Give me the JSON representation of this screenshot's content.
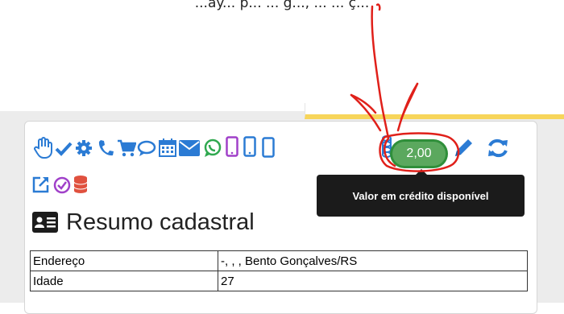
{
  "top_caption": "...ay... p... ... g..., ... ... ç...",
  "toolbar": {
    "icons": [
      {
        "name": "hand-icon",
        "color": "#2b7bd4"
      },
      {
        "name": "check-icon",
        "color": "#2b7bd4"
      },
      {
        "name": "gear-icon",
        "color": "#2b7bd4"
      },
      {
        "name": "phone-icon",
        "color": "#2b7bd4"
      },
      {
        "name": "cart-icon",
        "color": "#2b7bd4"
      },
      {
        "name": "chat-icon",
        "color": "#2b7bd4"
      },
      {
        "name": "calendar-icon",
        "color": "#2b7bd4"
      },
      {
        "name": "envelope-icon",
        "color": "#2b7bd4"
      },
      {
        "name": "whatsapp-icon",
        "color": "#2fa84f"
      },
      {
        "name": "mobile-purple-icon",
        "color": "#a040c9"
      },
      {
        "name": "mobile-blue-icon",
        "color": "#2b7bd4"
      },
      {
        "name": "pencil-icon",
        "color": "#2b7bd4"
      },
      {
        "name": "refresh-icon",
        "color": "#2b7bd4"
      },
      {
        "name": "external-link-icon",
        "color": "#2b7bd4"
      },
      {
        "name": "check-circle-icon",
        "color": "#a040c9"
      },
      {
        "name": "database-icon",
        "color": "#e0513f"
      }
    ],
    "credit_badge": "2,00",
    "credit_tooltip": "Valor em crédito disponível"
  },
  "section": {
    "title": "Resumo cadastral",
    "icon": "id-card-icon"
  },
  "table": {
    "rows": [
      {
        "label": "Endereço",
        "value": "-, , , Bento Gonçalves/RS"
      },
      {
        "label": "Idade",
        "value": "27"
      }
    ]
  },
  "colors": {
    "accent_blue": "#2b7bd4",
    "badge_green": "#5ba85e",
    "annotation_red": "#e0201a",
    "tooltip_bg": "#1b1b1b"
  }
}
